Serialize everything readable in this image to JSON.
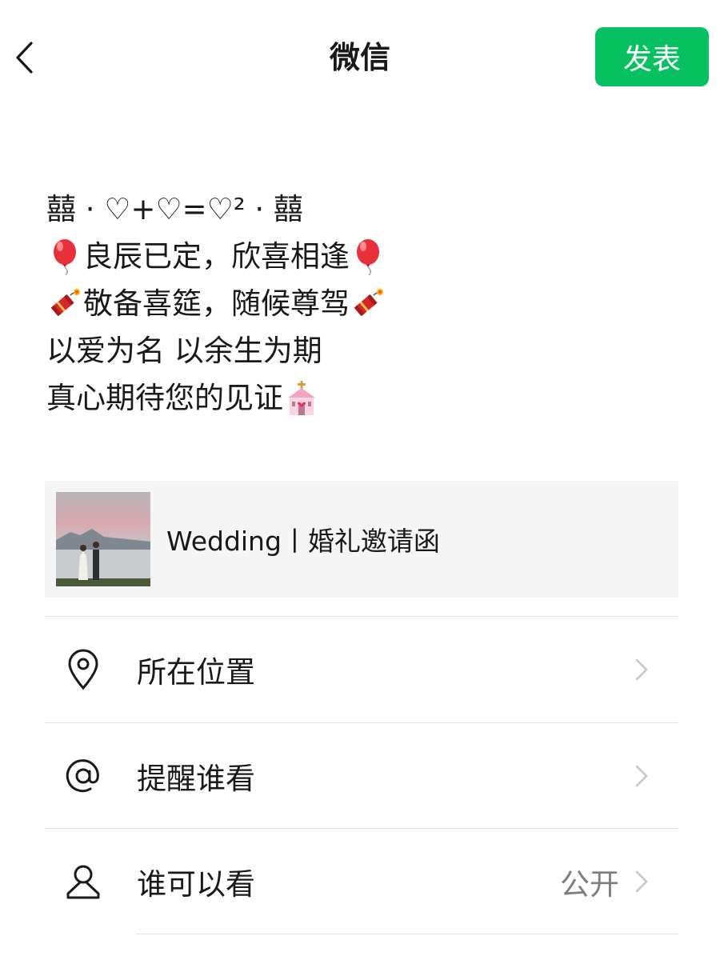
{
  "header": {
    "title": "微信",
    "publish_label": "发表"
  },
  "post": {
    "lines": [
      {
        "text": "囍 · ♡+♡=♡² · 囍"
      },
      {
        "before_emoji": "balloon",
        "text": " 良辰已定，欣喜相逢",
        "after_emoji": "balloon"
      },
      {
        "before_emoji": "firecracker",
        "text": "敬备喜筵，随候尊驾",
        "after_emoji": "firecracker"
      },
      {
        "text": "以爱为名 以余生为期"
      },
      {
        "text": "真心期待您的见证",
        "after_emoji": "wedding-chapel"
      }
    ]
  },
  "link_card": {
    "title": "Wedding丨婚礼邀请函",
    "thumbnail": "wedding-couple-photo"
  },
  "options": [
    {
      "label": "所在位置",
      "icon": "location-pin-icon",
      "value": ""
    },
    {
      "label": "提醒谁看",
      "icon": "at-sign-icon",
      "value": ""
    },
    {
      "label": "谁可以看",
      "icon": "person-icon",
      "value": "公开"
    }
  ],
  "colors": {
    "accent": "#07c160",
    "card_bg": "#f5f5f5",
    "divider": "#e5e5e5",
    "secondary_text": "#7f7f7f"
  }
}
